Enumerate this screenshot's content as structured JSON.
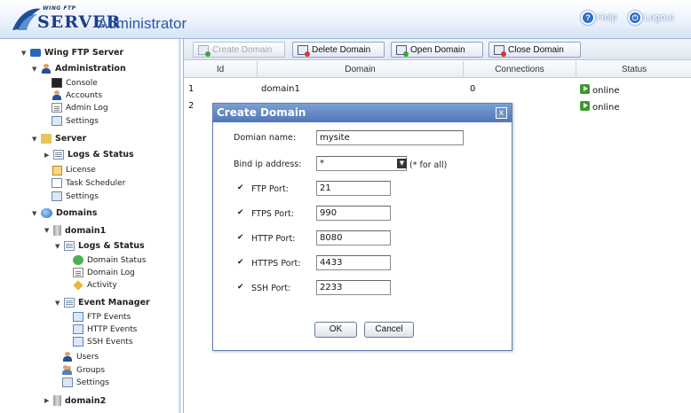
{
  "header": {
    "logo_small": "WING FTP",
    "logo_server": "SERVER",
    "title": "Administrator",
    "help_label": "Help",
    "logout_label": "Logout"
  },
  "tree": {
    "root": "Wing FTP Server",
    "administration": "Administration",
    "console": "Console",
    "accounts": "Accounts",
    "admin_log": "Admin Log",
    "admin_settings": "Settings",
    "server": "Server",
    "logs_status": "Logs & Status",
    "license": "License",
    "task_scheduler": "Task Scheduler",
    "server_settings": "Settings",
    "domains": "Domains",
    "domain1": "domain1",
    "d1_logs_status": "Logs & Status",
    "domain_status": "Domain Status",
    "domain_log": "Domain Log",
    "activity": "Activity",
    "event_manager": "Event Manager",
    "ftp_events": "FTP Events",
    "http_events": "HTTP Events",
    "ssh_events": "SSH Events",
    "users": "Users",
    "groups": "Groups",
    "d1_settings": "Settings",
    "domain2": "domain2"
  },
  "toolbar": {
    "create_domain": "Create Domain",
    "delete_domain": "Delete Domain",
    "open_domain": "Open Domain",
    "close_domain": "Close Domain"
  },
  "grid": {
    "columns": [
      "Id",
      "Domain",
      "Connections",
      "Status"
    ],
    "rows": [
      {
        "id": "1",
        "domain": "domain1",
        "connections": "0",
        "status": "online"
      },
      {
        "id": "2",
        "domain": "",
        "connections": "",
        "status": "online"
      }
    ]
  },
  "dialog": {
    "title": "Create Domain",
    "close": "x",
    "domain_name_label": "Domian name:",
    "domain_name_value": "mysite",
    "bind_ip_label": "Bind ip address:",
    "bind_ip_value": "*",
    "bind_ip_hint": "(* for all)",
    "ftp_label": "FTP Port:",
    "ftp_value": "21",
    "ftps_label": "FTPS Port:",
    "ftps_value": "990",
    "http_label": "HTTP Port:",
    "http_value": "8080",
    "https_label": "HTTPS Port:",
    "https_value": "4433",
    "ssh_label": "SSH Port:",
    "ssh_value": "2233",
    "check": "✔",
    "ok_label": "OK",
    "cancel_label": "Cancel"
  },
  "colors": {
    "accent": "#4f76b8",
    "online": "#3b9a2e",
    "header_text": "#2a58a8"
  }
}
